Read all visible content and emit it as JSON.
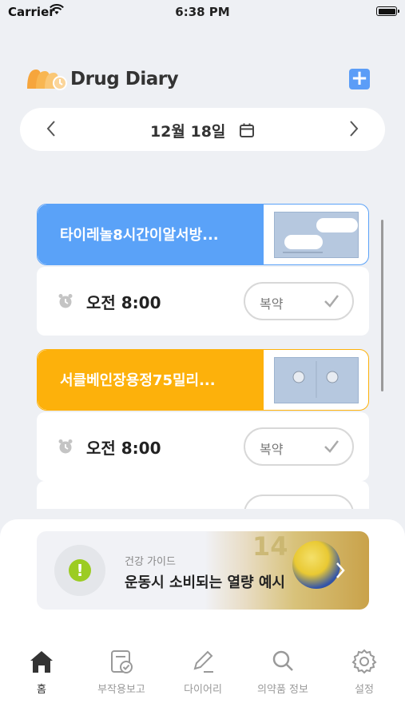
{
  "status": {
    "carrier": "Carrier",
    "time": "6:38 PM"
  },
  "header": {
    "title": "Drug Diary",
    "add_icon": "plus-icon"
  },
  "date": {
    "label": "12월 18일"
  },
  "doses": [
    {
      "drug": "타이레놀8시간이알서방...",
      "color": "#5aa2f8",
      "time": "오전 8:00",
      "take_label": "복약"
    },
    {
      "drug": "서클베인장용정75밀리...",
      "color": "#fdb10b",
      "time": "오전 8:00",
      "take_label": "복약"
    }
  ],
  "guide": {
    "subtitle": "건강 가이드",
    "title": "운동시 소비되는 열량 예시",
    "image_text": "14"
  },
  "tabs": [
    {
      "label": "홈",
      "icon": "home-icon",
      "active": true
    },
    {
      "label": "부작용보고",
      "icon": "report-icon",
      "active": false
    },
    {
      "label": "다이어리",
      "icon": "pencil-icon",
      "active": false
    },
    {
      "label": "의약품 정보",
      "icon": "search-icon",
      "active": false
    },
    {
      "label": "설정",
      "icon": "gear-icon",
      "active": false
    }
  ]
}
